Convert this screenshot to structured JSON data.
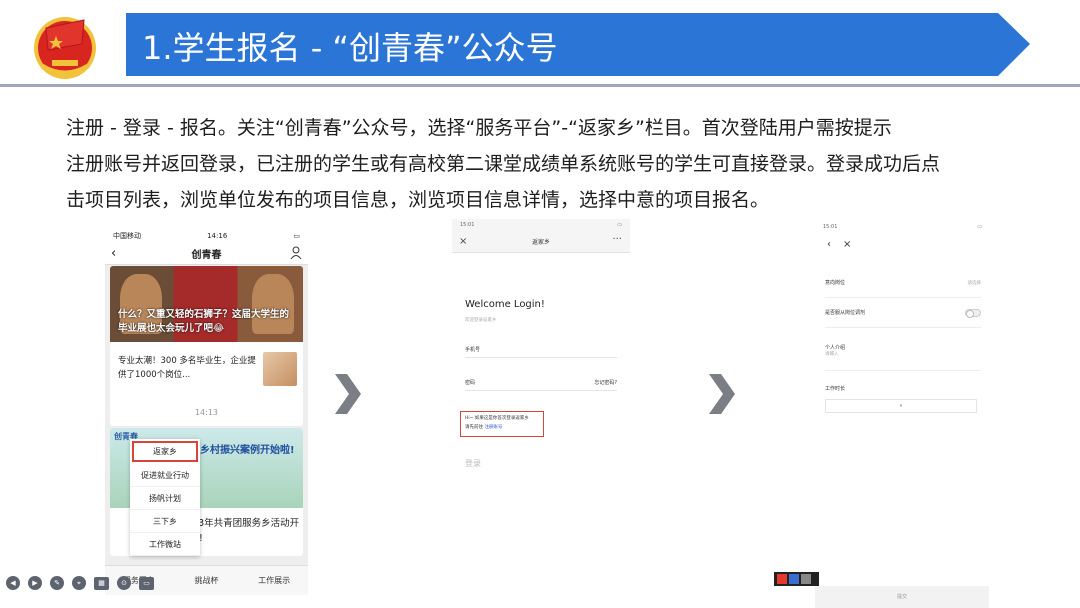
{
  "header": {
    "title": "1.学生报名 - “创青春”公众号",
    "colors": {
      "banner": "#2a75d6",
      "rule": "#9fa9b6",
      "logo_red": "#d8251f",
      "logo_gold": "#f2c23b"
    }
  },
  "intro": {
    "lines": [
      "注册 - 登录 - 报名。关注“创青春”公众号，选择“服务平台”-“返家乡”栏目。首次登陆用户需按提示",
      "注册账号并返回登录，已注册的学生或有高校第二课堂成绩单系统账号的学生可直接登录。登录成功后点",
      "击项目列表，浏览单位发布的项目信息，浏览项目信息详情，选择中意的项目报名。"
    ]
  },
  "phone1": {
    "status_left": "中国移动",
    "status_time": "14:16",
    "nav_title": "创青春",
    "card1_caption": "什么？又重又轻的石狮子？这届大学生的毕业展也太会玩儿了吧😂",
    "card1_news": "专业太潮！300 多名毕业生，企业提供了1000个岗位...",
    "time_divider": "14:13",
    "card2_brand": "创青春",
    "card2_banner_title": "乡村振兴案例开始啦!",
    "card2_text": "2023年共青团服务乡活动开始啦!",
    "menu_items": [
      "返家乡",
      "促进就业行动",
      "扬帆计划",
      "三下乡",
      "工作微站"
    ],
    "bottom_tabs": [
      "服务平台",
      "挑战杯",
      "工作展示"
    ],
    "highlight_color": "#d6453a"
  },
  "phone2": {
    "status_time": "15:01",
    "nav_title": "返家乡",
    "welcome": "Welcome Login!",
    "welcome_sub": "欢迎登录返家乡",
    "phone_label": "手机号",
    "password_label": "密码",
    "forgot_label": "忘记密码?",
    "notice_line1": "Hi~ 如果这是你首次登录返家乡",
    "notice_line2_prefix": "请先前往",
    "notice_link": "注册账号",
    "login_button": "登录"
  },
  "phone3": {
    "status_time": "15:01",
    "row1_label": "意向岗位",
    "row1_value": "请选择",
    "row2_label": "是否服从岗位调剂",
    "row3_label": "个人介绍",
    "row3_placeholder": "请输入",
    "row4_label": "工作时长",
    "footer": "提交"
  },
  "toolbar": {
    "icons": [
      "prev-icon",
      "play-icon",
      "pen-icon",
      "screenshot-icon",
      "slides-icon",
      "cursor-icon",
      "chat-icon"
    ]
  }
}
